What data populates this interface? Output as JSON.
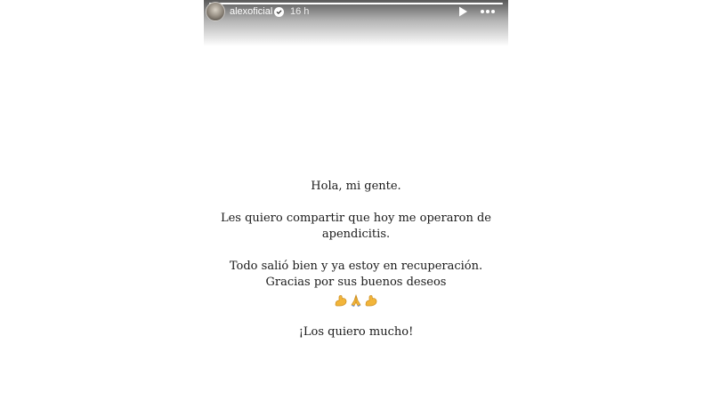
{
  "story": {
    "username": "alexoficial",
    "timestamp": "16 h",
    "progress": 1.0,
    "icons": {
      "avatar": "profile-avatar",
      "verified": "verified-badge-icon",
      "play": "play-icon",
      "more": "more-options-icon"
    }
  },
  "message": {
    "greeting": "Hola, mi gente.",
    "line_1": "Les quiero compartir que hoy me operaron de",
    "line_2": "apendicitis.",
    "line_3": "Todo salió bien y ya estoy en recuperación.",
    "line_4": "Gracias por sus buenos deseos",
    "emojis": "💪🙏💪",
    "closing": "¡Los quiero mucho!"
  },
  "colors": {
    "text": "#1a1a1a",
    "background": "#ffffff",
    "emoji": "#f2b53a"
  }
}
